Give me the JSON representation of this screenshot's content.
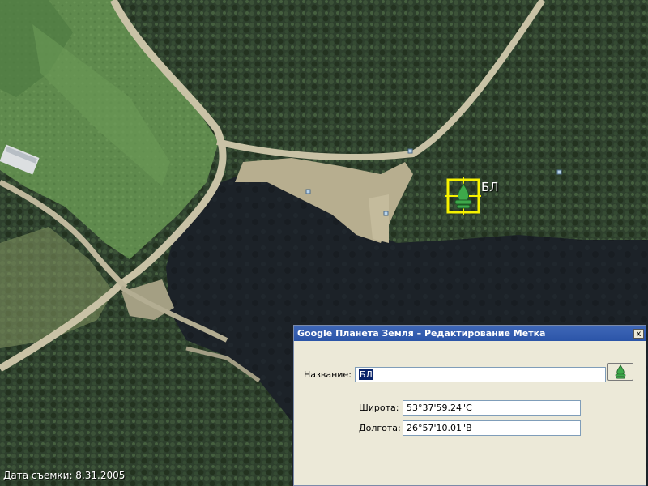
{
  "map": {
    "placemark_label": "БЛ",
    "placemark_icon": "campfire-icon",
    "capture_date": "Дата съемки: 8.31.2005"
  },
  "dialog": {
    "title": "Google Планета Земля – Редактирование Метка",
    "close_label": "x",
    "name_label": "Название:",
    "name_value": "БЛ",
    "latitude_label": "Широта:",
    "latitude_value": "53°37'59.24\"С",
    "longitude_label": "Долгота:",
    "longitude_value": "26°57'10.01\"В",
    "icon_button": "campfire-icon"
  },
  "colors": {
    "titlebar": "#2b55a8",
    "dialog_bg": "#ece9d8",
    "placemark_frame": "#f5f200",
    "placemark_icon": "#3ea94a",
    "lake": "#1b2127",
    "forest": "#2c3d2b"
  }
}
